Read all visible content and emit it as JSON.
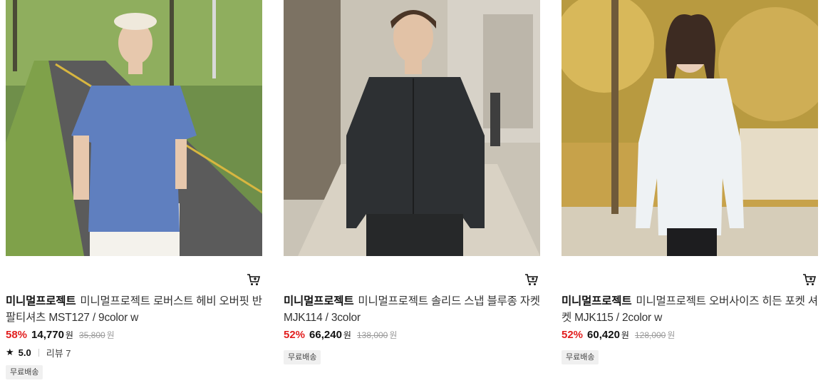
{
  "products": [
    {
      "brand": "미니멀프로젝트",
      "name": "미니멀프로젝트 로버스트 헤비 오버핏 반팔티셔츠 MST127 / 9color w",
      "discount": "58%",
      "sale_price": "14,770",
      "currency": "원",
      "original_price": "35,800",
      "rating": "5.0",
      "review_label": "리뷰 7",
      "badge": "무료배송",
      "image_icon": "product-photo-blue-tshirt"
    },
    {
      "brand": "미니멀프로젝트",
      "name": "미니멀프로젝트 솔리드 스냅 블루종 자켓 MJK114 / 3color",
      "discount": "52%",
      "sale_price": "66,240",
      "currency": "원",
      "original_price": "138,000",
      "badge": "무료배송",
      "image_icon": "product-photo-black-jacket"
    },
    {
      "brand": "미니멀프로젝트",
      "name": "미니멀프로젝트 오버사이즈 히든 포켓 셔켓 MJK115 / 2color w",
      "discount": "52%",
      "sale_price": "60,420",
      "currency": "원",
      "original_price": "128,000",
      "badge": "무료배송",
      "image_icon": "product-photo-white-shirt"
    }
  ],
  "colors": {
    "discount": "#e21e1e",
    "badge_bg": "#f0f0f0"
  }
}
